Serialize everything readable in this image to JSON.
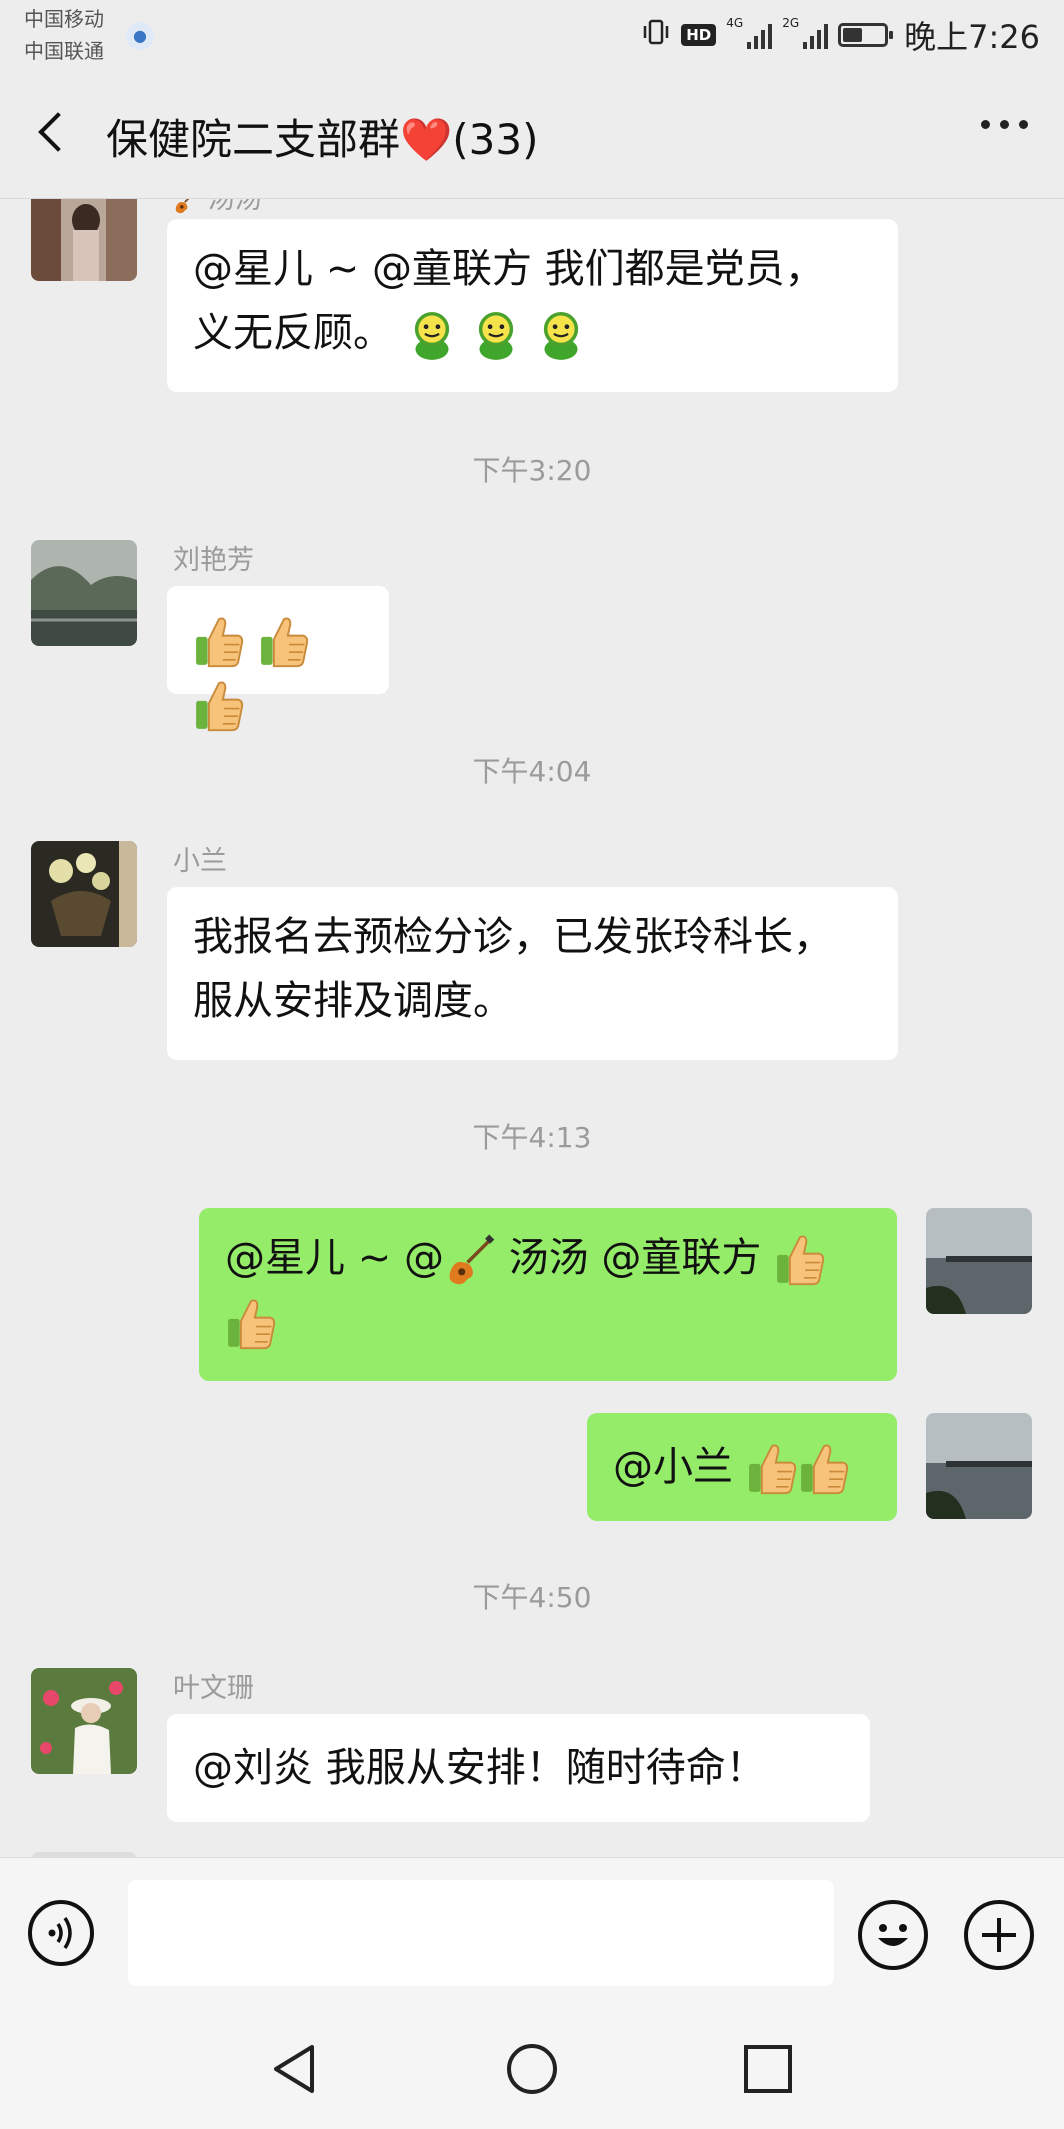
{
  "status_bar": {
    "carrier_1": "中国移动",
    "carrier_2": "中国联通",
    "hd_label": "HD",
    "net_1": "4G",
    "net_2": "2G",
    "time": "晚上7:26"
  },
  "header": {
    "title": "保健院二支部群❤️(33)",
    "back_icon": "chevron-left-icon",
    "more_icon": "more-horizontal-icon"
  },
  "messages": [
    {
      "partial_sender": "汤汤",
      "text_line1": "@星儿 ~ @童联方  我们都是党员，",
      "text_line2": "义无反顾。",
      "emoji": "smiley-emoji x3"
    },
    {
      "time": "下午3:20"
    },
    {
      "sender": "刘艳芳",
      "emoji": "thumbs-up x3"
    },
    {
      "time": "下午4:04"
    },
    {
      "sender": "小兰",
      "text_line1": "我报名去预检分诊，已发张玲科长，",
      "text_line2": "服从安排及调度。"
    },
    {
      "time": "下午4:13"
    },
    {
      "mine": true,
      "text_a": "@星儿 ~ @",
      "text_b": " 汤汤  @童联方 ",
      "emoji": "guitar, thumbs-up x2"
    },
    {
      "mine": true,
      "text": "@小兰 ",
      "emoji": "thumbs-up x2"
    },
    {
      "time": "下午4:50"
    },
    {
      "sender": "叶文珊",
      "text": "@刘炎  我服从安排！随时待命！"
    }
  ],
  "input_bar": {
    "voice_icon": "voice-icon",
    "emoji_icon": "emoji-icon",
    "plus_icon": "plus-icon"
  },
  "nav_bar": {
    "back_icon": "nav-back-icon",
    "home_icon": "nav-home-icon",
    "recents_icon": "nav-recents-icon"
  },
  "colors": {
    "background": "#ededed",
    "bubble_other": "#ffffff",
    "bubble_mine": "#95ec69",
    "meta_text": "#9b9b9b"
  }
}
